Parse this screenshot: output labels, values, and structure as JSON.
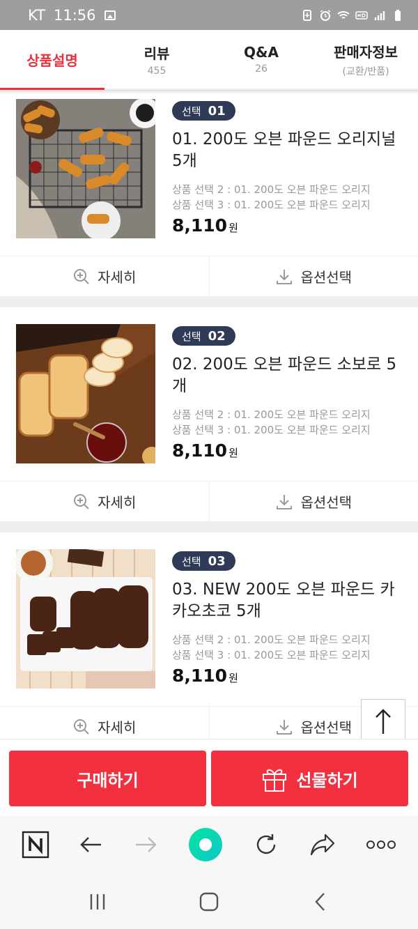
{
  "status_bar": {
    "carrier": "KT",
    "time": "11:56"
  },
  "tabs": [
    {
      "label": "상품설명",
      "sub": "",
      "active": true
    },
    {
      "label": "리뷰",
      "sub": "455",
      "active": false
    },
    {
      "label": "Q&A",
      "sub": "26",
      "active": false
    },
    {
      "label": "판매자정보",
      "sub": "(교환/반품)",
      "active": false
    }
  ],
  "products": [
    {
      "badge_text": "선택",
      "badge_num": "01",
      "name": "01. 200도 오븐 파운드 오리지널 5개",
      "option_line_1": "상품 선택 2 : 01. 200도 오븐 파운드 오리지",
      "option_line_2": "상품 선택 3 : 01. 200도 오븐 파운드 오리지",
      "price": "8,110",
      "currency": "원",
      "detail_label": "자세히",
      "option_label": "옵션선택"
    },
    {
      "badge_text": "선택",
      "badge_num": "02",
      "name": "02. 200도 오븐 파운드 소보로 5개",
      "option_line_1": "상품 선택 2 : 01. 200도 오븐 파운드 오리지",
      "option_line_2": "상품 선택 3 : 01. 200도 오븐 파운드 오리지",
      "price": "8,110",
      "currency": "원",
      "detail_label": "자세히",
      "option_label": "옵션선택"
    },
    {
      "badge_text": "선택",
      "badge_num": "03",
      "name": "03. NEW 200도 오븐 파운드 카카오초코 5개",
      "option_line_1": "상품 선택 2 : 01. 200도 오븐 파운드 오리지",
      "option_line_2": "상품 선택 3 : 01. 200도 오븐 파운드 오리지",
      "price": "8,110",
      "currency": "원",
      "detail_label": "자세히",
      "option_label": "옵션선택"
    }
  ],
  "buy_bar": {
    "buy_label": "구매하기",
    "gift_label": "선물하기"
  },
  "colors": {
    "accent": "#f2303f",
    "badge": "#2f3a56",
    "tab_active": "#e5323e",
    "browser_home": "#1de9b6"
  },
  "icons": {
    "browser": [
      "naver-n-icon",
      "back-arrow-icon",
      "forward-arrow-icon",
      "home-circle-icon",
      "refresh-icon",
      "share-icon",
      "more-dots-icon"
    ],
    "nav": [
      "recent-apps-icon",
      "home-icon",
      "back-icon"
    ]
  }
}
